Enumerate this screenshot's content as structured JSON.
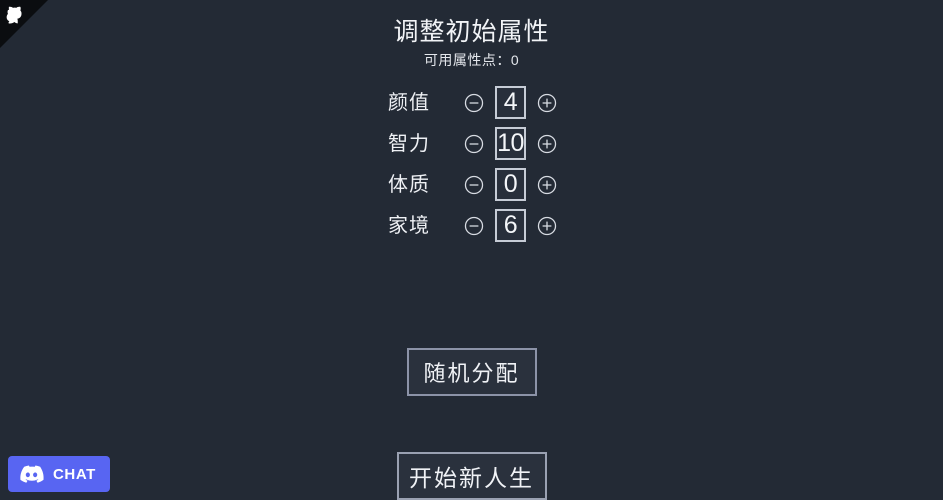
{
  "app": {
    "background_color": "#232a35",
    "text_color": "#f2f4f7"
  },
  "corner": {
    "icon": "octocat-corner-icon",
    "ribbon_color": "#0b0d10"
  },
  "header": {
    "title": "调整初始属性",
    "points_label": "可用属性点：0"
  },
  "attributes": {
    "decrement_icon": "circle-minus-icon",
    "increment_icon": "circle-plus-icon",
    "rows": [
      {
        "label": "颜值",
        "value": "4"
      },
      {
        "label": "智力",
        "value": "10"
      },
      {
        "label": "体质",
        "value": "0"
      },
      {
        "label": "家境",
        "value": "6"
      }
    ]
  },
  "actions": {
    "random_label": "随机分配",
    "start_label": "开始新人生"
  },
  "chat_widget": {
    "label": "CHAT",
    "icon": "discord-icon",
    "brand_color": "#5865f2"
  }
}
